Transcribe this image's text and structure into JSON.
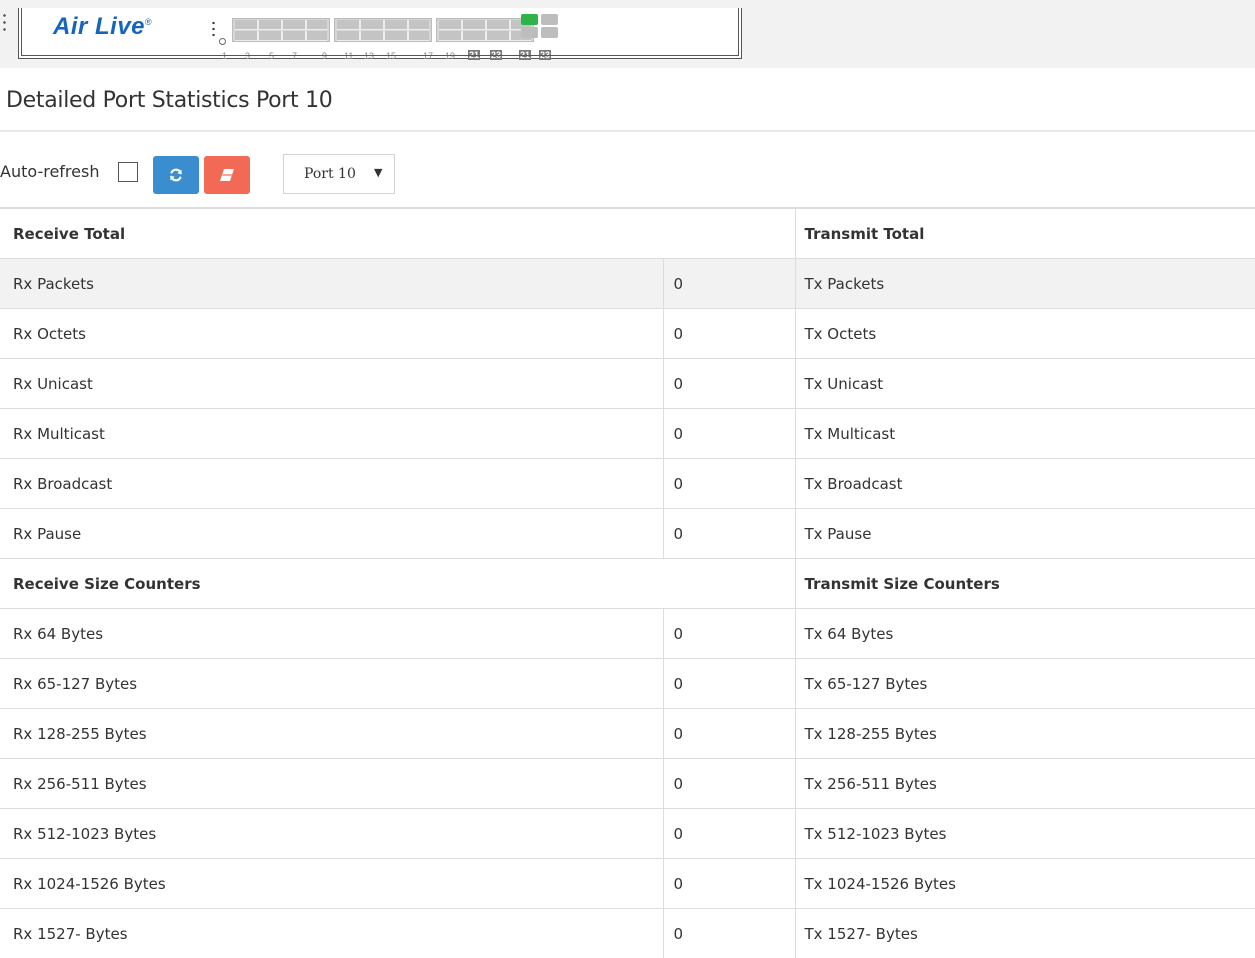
{
  "panel": {
    "brand": "Air Live",
    "brand_mark": "®",
    "port_numbers": [
      "1",
      "3",
      "5",
      "7",
      "9",
      "11",
      "13",
      "15",
      "17",
      "19",
      "21",
      "23",
      "21",
      "23"
    ]
  },
  "page": {
    "title": "Detailed Port Statistics  Port 10"
  },
  "toolbar": {
    "auto_refresh_label": "Auto-refresh",
    "auto_refresh_checked": false,
    "refresh_icon": "refresh-icon",
    "clear_icon": "eraser-icon",
    "refresh_color": "#3a8ed0",
    "clear_color": "#f26a55",
    "port_select": {
      "value": "Port 10"
    }
  },
  "stats": {
    "receive_total_header": "Receive Total",
    "transmit_total_header": "Transmit Total",
    "receive_size_header": "Receive Size Counters",
    "transmit_size_header": "Transmit Size Counters",
    "total_rows": [
      {
        "rx_label": "Rx Packets",
        "rx_value": "0",
        "tx_label": "Tx Packets"
      },
      {
        "rx_label": "Rx Octets",
        "rx_value": "0",
        "tx_label": "Tx Octets"
      },
      {
        "rx_label": "Rx Unicast",
        "rx_value": "0",
        "tx_label": "Tx Unicast"
      },
      {
        "rx_label": "Rx Multicast",
        "rx_value": "0",
        "tx_label": "Tx Multicast"
      },
      {
        "rx_label": "Rx Broadcast",
        "rx_value": "0",
        "tx_label": "Tx Broadcast"
      },
      {
        "rx_label": "Rx Pause",
        "rx_value": "0",
        "tx_label": "Tx Pause"
      }
    ],
    "size_rows": [
      {
        "rx_label": "Rx 64 Bytes",
        "rx_value": "0",
        "tx_label": "Tx 64 Bytes"
      },
      {
        "rx_label": "Rx 65-127 Bytes",
        "rx_value": "0",
        "tx_label": "Tx 65-127 Bytes"
      },
      {
        "rx_label": "Rx 128-255 Bytes",
        "rx_value": "0",
        "tx_label": "Tx 128-255 Bytes"
      },
      {
        "rx_label": "Rx 256-511 Bytes",
        "rx_value": "0",
        "tx_label": "Tx 256-511 Bytes"
      },
      {
        "rx_label": "Rx 512-1023 Bytes",
        "rx_value": "0",
        "tx_label": "Tx 512-1023 Bytes"
      },
      {
        "rx_label": "Rx 1024-1526 Bytes",
        "rx_value": "0",
        "tx_label": "Tx 1024-1526 Bytes"
      },
      {
        "rx_label": "Rx 1527- Bytes",
        "rx_value": "0",
        "tx_label": "Tx 1527- Bytes"
      }
    ]
  }
}
